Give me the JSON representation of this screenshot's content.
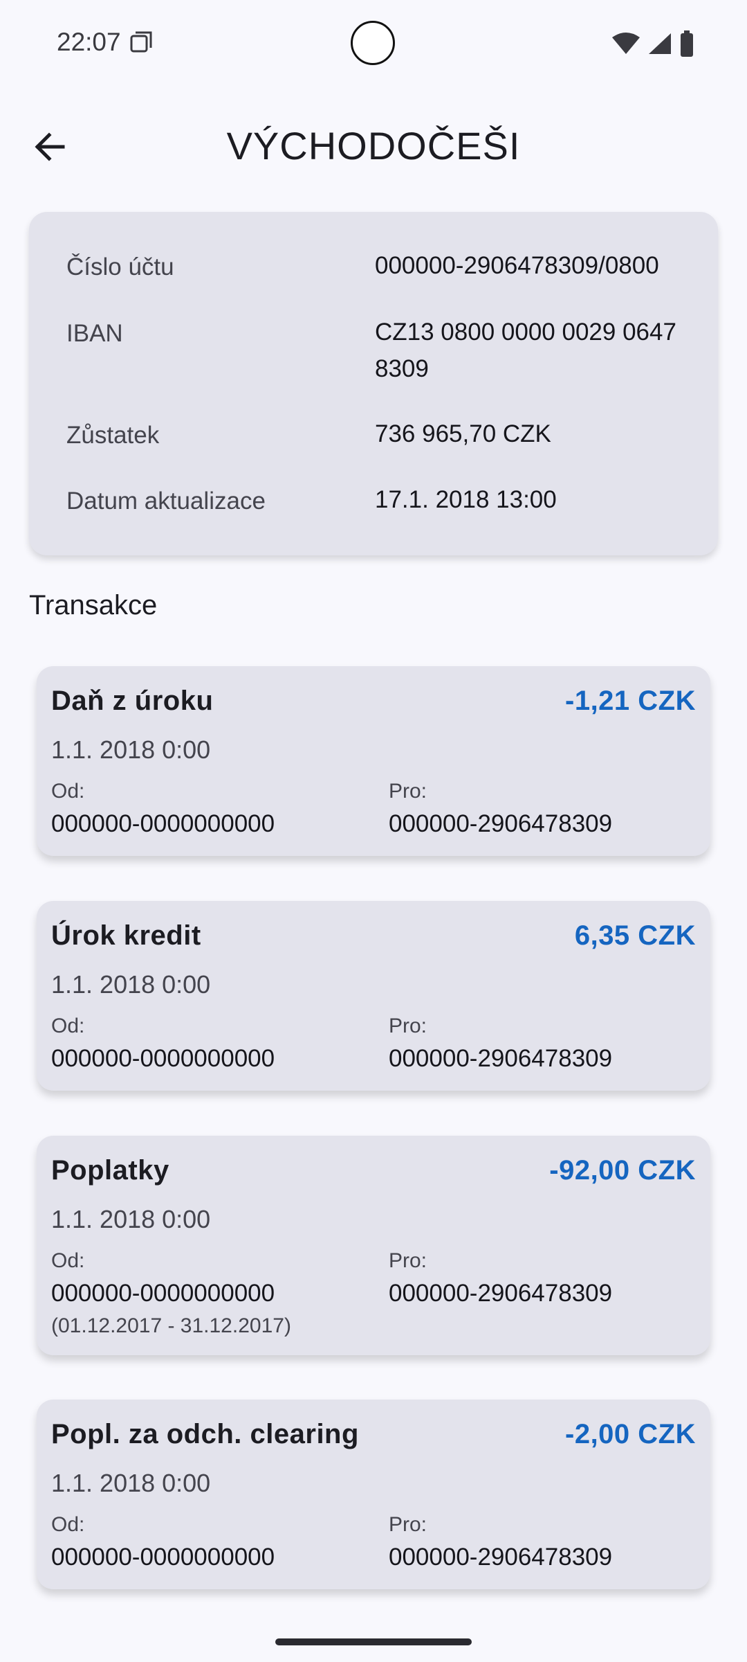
{
  "status_bar": {
    "time": "22:07",
    "icons": [
      "screenshot-icon",
      "wifi-icon",
      "signal-icon",
      "battery-icon"
    ]
  },
  "app_bar": {
    "title": "VÝCHODOČEŠI",
    "back_icon": "arrow-back-icon"
  },
  "account": {
    "rows": [
      {
        "label": "Číslo účtu",
        "value": "000000-2906478309/0800"
      },
      {
        "label": "IBAN",
        "value": "CZ13 0800 0000 0029 0647 8309"
      },
      {
        "label": "Zůstatek",
        "value": "736 965,70 CZK"
      },
      {
        "label": "Datum aktualizace",
        "value": "17.1. 2018 13:00"
      }
    ]
  },
  "transactions_title": "Transakce",
  "transactions": [
    {
      "title": "Daň z úroku",
      "amount": "-1,21 CZK",
      "date": "1.1. 2018 0:00",
      "from_label": "Od:",
      "from": "000000-0000000000",
      "to_label": "Pro:",
      "to": "000000-2906478309",
      "note": ""
    },
    {
      "title": "Úrok kredit",
      "amount": "6,35 CZK",
      "date": "1.1. 2018 0:00",
      "from_label": "Od:",
      "from": "000000-0000000000",
      "to_label": "Pro:",
      "to": "000000-2906478309",
      "note": ""
    },
    {
      "title": "Poplatky",
      "amount": "-92,00 CZK",
      "date": "1.1. 2018 0:00",
      "from_label": "Od:",
      "from": "000000-0000000000",
      "to_label": "Pro:",
      "to": "000000-2906478309",
      "note": "(01.12.2017 - 31.12.2017)"
    },
    {
      "title": "Popl. za odch. clearing",
      "amount": "-2,00 CZK",
      "date": "1.1. 2018 0:00",
      "from_label": "Od:",
      "from": "000000-0000000000",
      "to_label": "Pro:",
      "to": "000000-2906478309",
      "note": ""
    }
  ],
  "colors": {
    "background": "#f8f8fd",
    "card": "#e3e3ec",
    "amount": "#1565c0",
    "text": "#1c1c22"
  }
}
